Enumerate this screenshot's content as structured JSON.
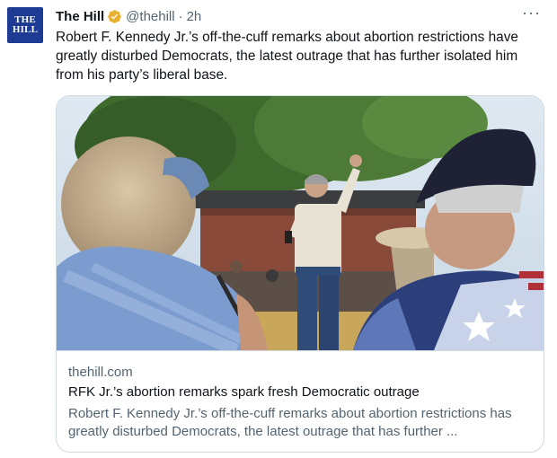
{
  "author": {
    "avatar_text_line1": "THE",
    "avatar_text_line2": "HILL",
    "name": "The Hill",
    "handle": "@thehill",
    "separator": "·",
    "time": "2h",
    "verified_color": "#e8b02c",
    "avatar_color": "#1d3b93"
  },
  "tweet": {
    "text": "Robert F. Kennedy Jr.’s off-the-cuff remarks about abortion restrictions have greatly disturbed Democrats, the latest outrage that has further isolated him from his party’s liberal base.",
    "more_icon": "more-horizontal-icon",
    "more_label": "···"
  },
  "link_card": {
    "image_icon": "photo-rally-image",
    "domain": "thehill.com",
    "title": "RFK Jr.’s abortion remarks spark fresh Democratic outrage",
    "description": "Robert F. Kennedy Jr.’s off-the-cuff remarks about abortion restrictions has greatly disturbed Democrats, the latest outrage that has further ..."
  }
}
